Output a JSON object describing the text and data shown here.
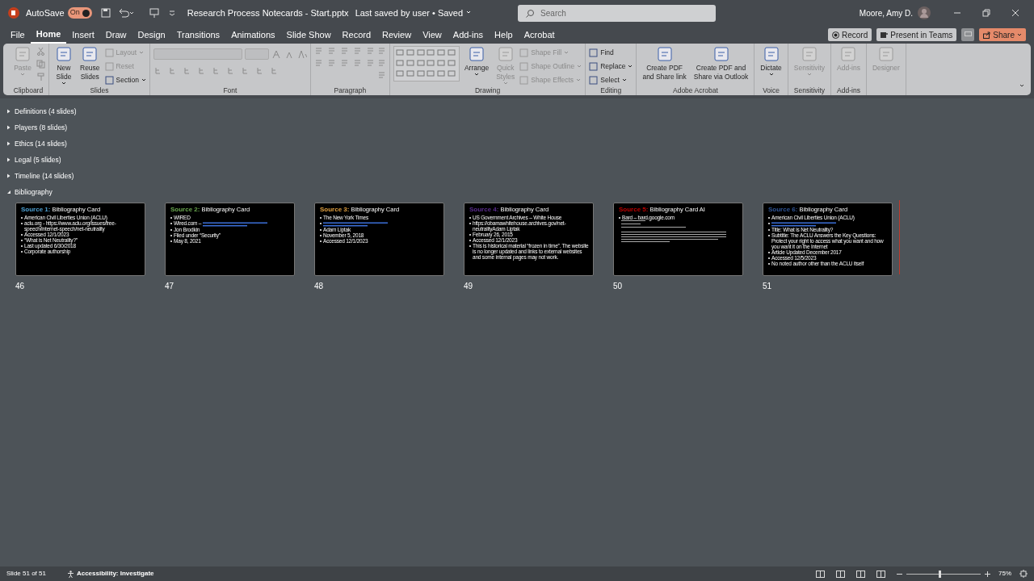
{
  "titlebar": {
    "autosave_label": "AutoSave",
    "autosave_toggle": {
      "label": "On",
      "on": true
    },
    "document": "Research Process Notecards - Start.pptx",
    "save_status": "Last saved by user • Saved",
    "search": {
      "placeholder": "Search"
    },
    "user": "Moore, Amy D."
  },
  "menu_tabs": [
    {
      "label": "File",
      "selected": false
    },
    {
      "label": "Home",
      "selected": true
    },
    {
      "label": "Insert",
      "selected": false
    },
    {
      "label": "Draw",
      "selected": false
    },
    {
      "label": "Design",
      "selected": false
    },
    {
      "label": "Transitions",
      "selected": false
    },
    {
      "label": "Animations",
      "selected": false
    },
    {
      "label": "Slide Show",
      "selected": false
    },
    {
      "label": "Record",
      "selected": false
    },
    {
      "label": "Review",
      "selected": false
    },
    {
      "label": "View",
      "selected": false
    },
    {
      "label": "Add-ins",
      "selected": false
    },
    {
      "label": "Help",
      "selected": false
    },
    {
      "label": "Acrobat",
      "selected": false
    }
  ],
  "ribbon_actions": [
    {
      "kind": "record",
      "label": "Record"
    },
    {
      "kind": "teams",
      "label": "Present in Teams"
    },
    {
      "kind": "comments"
    },
    {
      "kind": "share",
      "label": "Share"
    }
  ],
  "ribbon_groups": [
    {
      "label": "Clipboard",
      "kind": "clipboard",
      "controls": [
        {
          "kind": "large",
          "lines": [
            "Paste"
          ],
          "disabled": true,
          "menu": true
        }
      ]
    },
    {
      "label": "Slides",
      "kind": "buttons",
      "controls": [
        {
          "kind": "large",
          "lines": [
            "New",
            "Slide"
          ],
          "disabled": false,
          "menu": true
        },
        {
          "kind": "large",
          "lines": [
            "Reuse",
            "Slides"
          ],
          "disabled": false,
          "menu": false
        },
        {
          "kind": "small",
          "label": "Layout",
          "disabled": true,
          "menu": true
        },
        {
          "kind": "small",
          "label": "Reset",
          "disabled": true,
          "menu": false
        },
        {
          "kind": "small",
          "label": "Section",
          "disabled": false,
          "menu": true
        }
      ]
    },
    {
      "label": "Font",
      "kind": "font"
    },
    {
      "label": "Paragraph",
      "kind": "paragraph"
    },
    {
      "label": "Drawing",
      "kind": "drawing",
      "controls": [
        {
          "kind": "large",
          "lines": [
            "Arrange"
          ],
          "disabled": false,
          "menu": true
        },
        {
          "kind": "large",
          "lines": [
            "Quick",
            "Styles"
          ],
          "disabled": true,
          "menu": true
        },
        {
          "kind": "small",
          "label": "Shape Fill",
          "disabled": true,
          "menu": true
        },
        {
          "kind": "small",
          "label": "Shape Outline",
          "disabled": true,
          "menu": true
        },
        {
          "kind": "small",
          "label": "Shape Effects",
          "disabled": true,
          "menu": true
        }
      ]
    },
    {
      "label": "Editing",
      "kind": "buttons",
      "controls": [
        {
          "kind": "small",
          "label": "Find",
          "disabled": false,
          "menu": false
        },
        {
          "kind": "small",
          "label": "Replace",
          "disabled": false,
          "menu": true
        },
        {
          "kind": "small",
          "label": "Select",
          "disabled": false,
          "menu": true
        }
      ]
    },
    {
      "label": "Adobe Acrobat",
      "kind": "buttons",
      "controls": [
        {
          "kind": "large",
          "lines": [
            "Create PDF",
            "and Share link"
          ],
          "disabled": false,
          "menu": false
        },
        {
          "kind": "large",
          "lines": [
            "Create PDF and",
            "Share via Outlook"
          ],
          "disabled": false,
          "menu": false
        }
      ]
    },
    {
      "label": "Voice",
      "kind": "buttons",
      "controls": [
        {
          "kind": "large",
          "lines": [
            "Dictate"
          ],
          "disabled": false,
          "menu": true
        }
      ]
    },
    {
      "label": "Sensitivity",
      "kind": "buttons",
      "controls": [
        {
          "kind": "large",
          "lines": [
            "Sensitivity"
          ],
          "disabled": true,
          "menu": true
        }
      ]
    },
    {
      "label": "Add-ins",
      "kind": "buttons",
      "controls": [
        {
          "kind": "large",
          "lines": [
            "Add-ins"
          ],
          "disabled": true,
          "menu": false
        }
      ]
    },
    {
      "kind": "buttons",
      "controls": [
        {
          "kind": "large",
          "lines": [
            "Designer"
          ],
          "disabled": true,
          "menu": false
        }
      ]
    }
  ],
  "sections": [
    {
      "label": "Definitions (4 slides)",
      "expanded": false
    },
    {
      "label": "Players (8 slides)",
      "expanded": false
    },
    {
      "label": "Ethics (14 slides)",
      "expanded": false
    },
    {
      "label": "Legal (5 slides)",
      "expanded": false
    },
    {
      "label": "Timeline (14 slides)",
      "expanded": false
    },
    {
      "label": "Bibliography",
      "expanded": true,
      "slides": [
        {
          "number": "46",
          "source": "Source 1:",
          "color": "#4ea1d3",
          "title": "Bibliography Card",
          "bullets": [
            {
              "kind": "text",
              "text": "American Civil Liberties Union (ACLU)"
            },
            {
              "kind": "text",
              "text": "aclu.org - https://www.aclu.org/issues/free-speech/internet-speech/net-neutrality"
            },
            {
              "kind": "text",
              "text": "Accessed 12/1/2023"
            },
            {
              "kind": "text",
              "text": "“What is Net Neutrality?”"
            },
            {
              "kind": "text",
              "text": "Last updated 6/30/2018"
            },
            {
              "kind": "text",
              "text": "Corporate authorship"
            }
          ]
        },
        {
          "number": "47",
          "source": "Source 2:",
          "color": "#6aa84f",
          "title": "Bibliography Card",
          "bullets": [
            {
              "kind": "text",
              "text": "WIRED"
            },
            {
              "kind": "link",
              "text": "Wired.com –"
            },
            {
              "kind": "text",
              "text": "Jon Brodkin"
            },
            {
              "kind": "text",
              "text": "Filed under “Security”"
            },
            {
              "kind": "text",
              "text": "May 8, 2021"
            }
          ]
        },
        {
          "number": "48",
          "source": "Source 3:",
          "color": "#e0a040",
          "title": "Bibliography Card",
          "bullets": [
            {
              "kind": "text",
              "text": "The New York Times"
            },
            {
              "kind": "link"
            },
            {
              "kind": "text",
              "text": "Adam Liptak"
            },
            {
              "kind": "text",
              "text": "November 5, 2018"
            },
            {
              "kind": "text",
              "text": "Accessed 12/1/2023"
            }
          ]
        },
        {
          "number": "49",
          "source": "Source 4:",
          "color": "#5b2c8f",
          "title": "Bibliography Card",
          "bullets": [
            {
              "kind": "text",
              "text": "US Government Archives – White House"
            },
            {
              "kind": "text",
              "text": "https://obamawhitehouse.archives.gov/net-neutralityAdam Liptak"
            },
            {
              "kind": "text",
              "text": "February 26, 2015"
            },
            {
              "kind": "text",
              "text": "Accessed 12/1/2023"
            },
            {
              "kind": "text",
              "text": "This is historical material “frozen in time”. The website is no longer updated and links to external websites and some internal pages may not work."
            }
          ]
        },
        {
          "number": "50",
          "source": "Source 5:",
          "color": "#c00000",
          "title": "Bibliography Card AI",
          "bullets": [
            {
              "kind": "text",
              "text": "Bard – bard.google.com"
            },
            {
              "kind": "fine"
            }
          ]
        },
        {
          "number": "51",
          "source": "Source 6:",
          "color": "#2f5597",
          "title": "Bibliography Card",
          "bullets": [
            {
              "kind": "text",
              "text": "American Civil Liberties Union (ACLU)"
            },
            {
              "kind": "link"
            },
            {
              "kind": "text",
              "text": "Title: What is Net Neutrality?"
            },
            {
              "kind": "text",
              "text": "Subtitle: The ACLU Answers the Key Questions: Protect your right to access what you want and how you want it on the Internet"
            },
            {
              "kind": "text",
              "text": "Article Updated December 2017"
            },
            {
              "kind": "text",
              "text": "Accessed 12/5/2023"
            },
            {
              "kind": "text",
              "text": "No noted author other than the ACLU itself"
            }
          ]
        }
      ]
    }
  ],
  "status_bar": {
    "slide_position": "Slide 51 of 51",
    "accessibility": "Accessibility: Investigate",
    "zoom": {
      "level": 0.45,
      "reading": "75%"
    }
  }
}
